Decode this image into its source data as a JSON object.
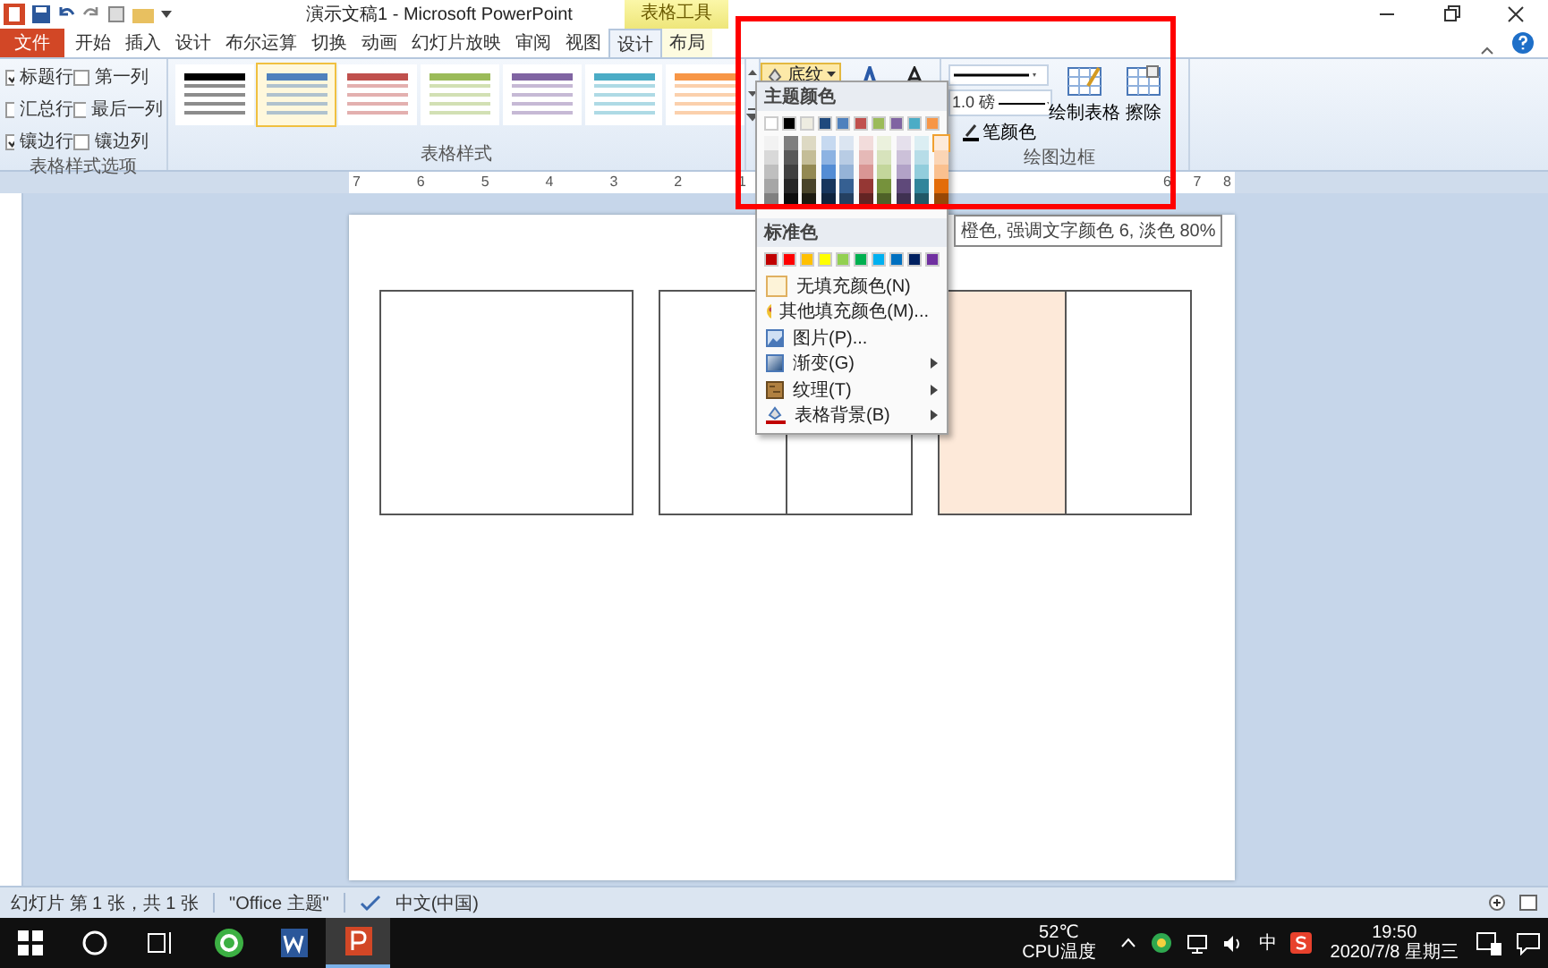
{
  "window": {
    "title": "演示文稿1 - Microsoft PowerPoint",
    "context_group": "表格工具"
  },
  "tabs": [
    {
      "label": "文件",
      "kind": "file",
      "selected": false
    },
    {
      "label": "开始",
      "kind": "normal",
      "selected": false
    },
    {
      "label": "插入",
      "kind": "normal",
      "selected": false
    },
    {
      "label": "设计",
      "kind": "normal",
      "selected": false
    },
    {
      "label": "布尔运算",
      "kind": "normal",
      "selected": false
    },
    {
      "label": "切换",
      "kind": "normal",
      "selected": false
    },
    {
      "label": "动画",
      "kind": "normal",
      "selected": false
    },
    {
      "label": "幻灯片放映",
      "kind": "normal",
      "selected": false
    },
    {
      "label": "审阅",
      "kind": "normal",
      "selected": false
    },
    {
      "label": "视图",
      "kind": "normal",
      "selected": false
    },
    {
      "label": "设计",
      "kind": "context",
      "selected": true
    },
    {
      "label": "布局",
      "kind": "context",
      "selected": false
    }
  ],
  "style_options": {
    "group_label": "表格样式选项",
    "items": [
      {
        "label": "标题行",
        "checked": true
      },
      {
        "label": "第一列",
        "checked": false
      },
      {
        "label": "汇总行",
        "checked": false
      },
      {
        "label": "最后一列",
        "checked": false
      },
      {
        "label": "镶边行",
        "checked": true
      },
      {
        "label": "镶边列",
        "checked": false
      }
    ]
  },
  "table_styles": {
    "group_label": "表格样式",
    "styles": [
      {
        "color": "#000000",
        "selected": false
      },
      {
        "color": "#4f81bd",
        "selected": true
      },
      {
        "color": "#c0504d",
        "selected": false
      },
      {
        "color": "#9bbb59",
        "selected": false
      },
      {
        "color": "#8064a2",
        "selected": false
      },
      {
        "color": "#4bacc6",
        "selected": false
      },
      {
        "color": "#f79646",
        "selected": false
      }
    ]
  },
  "shading_button": {
    "label": "底纹"
  },
  "draw_borders": {
    "group_label": "绘图边框",
    "pen_weight": "1.0 磅",
    "pen_color": "笔颜色",
    "draw_table": "绘制表格",
    "eraser": "擦除"
  },
  "ruler": {
    "left_labels": [
      "7",
      "6",
      "5",
      "4",
      "3",
      "2",
      "1"
    ],
    "right_labels": [
      "6",
      "7",
      "8"
    ]
  },
  "slide": {
    "tables": [
      {
        "cells": [
          {
            "shaded": false
          }
        ]
      },
      {
        "cells": [
          {
            "shaded": false
          },
          {
            "shaded": false
          }
        ]
      },
      {
        "cells": [
          {
            "shaded": true
          },
          {
            "shaded": false
          }
        ]
      }
    ]
  },
  "shading_menu": {
    "theme_header": "主题颜色",
    "standard_header": "标准色",
    "tooltip": "橙色, 强调文字颜色 6, 淡色 80%",
    "theme_colors": [
      {
        "color": "#ffffff",
        "selected": false,
        "shades": [
          {
            "color": "#f2f2f2",
            "selected": false
          },
          {
            "color": "#d9d9d9",
            "selected": false
          },
          {
            "color": "#bfbfbf",
            "selected": false
          },
          {
            "color": "#a6a6a6",
            "selected": false
          },
          {
            "color": "#808080",
            "selected": false
          }
        ]
      },
      {
        "color": "#000000",
        "selected": false,
        "shades": [
          {
            "color": "#7f7f7f",
            "selected": false
          },
          {
            "color": "#595959",
            "selected": false
          },
          {
            "color": "#404040",
            "selected": false
          },
          {
            "color": "#262626",
            "selected": false
          },
          {
            "color": "#0d0d0d",
            "selected": false
          }
        ]
      },
      {
        "color": "#eeece1",
        "selected": false,
        "shades": [
          {
            "color": "#ddd9c3",
            "selected": false
          },
          {
            "color": "#c4bd97",
            "selected": false
          },
          {
            "color": "#938953",
            "selected": false
          },
          {
            "color": "#494429",
            "selected": false
          },
          {
            "color": "#1d1b10",
            "selected": false
          }
        ]
      },
      {
        "color": "#1f497d",
        "selected": false,
        "shades": [
          {
            "color": "#c6d9f0",
            "selected": false
          },
          {
            "color": "#8db3e2",
            "selected": false
          },
          {
            "color": "#548dd4",
            "selected": false
          },
          {
            "color": "#17365d",
            "selected": false
          },
          {
            "color": "#0f243e",
            "selected": false
          }
        ]
      },
      {
        "color": "#4f81bd",
        "selected": false,
        "shades": [
          {
            "color": "#dbe5f1",
            "selected": false
          },
          {
            "color": "#b8cce4",
            "selected": false
          },
          {
            "color": "#95b3d7",
            "selected": false
          },
          {
            "color": "#366092",
            "selected": false
          },
          {
            "color": "#244061",
            "selected": false
          }
        ]
      },
      {
        "color": "#c0504d",
        "selected": false,
        "shades": [
          {
            "color": "#f2dcdb",
            "selected": false
          },
          {
            "color": "#e5b9b7",
            "selected": false
          },
          {
            "color": "#d99694",
            "selected": false
          },
          {
            "color": "#953734",
            "selected": false
          },
          {
            "color": "#632423",
            "selected": false
          }
        ]
      },
      {
        "color": "#9bbb59",
        "selected": false,
        "shades": [
          {
            "color": "#ebf1dd",
            "selected": false
          },
          {
            "color": "#d7e3bc",
            "selected": false
          },
          {
            "color": "#c3d69b",
            "selected": false
          },
          {
            "color": "#76923c",
            "selected": false
          },
          {
            "color": "#4f6128",
            "selected": false
          }
        ]
      },
      {
        "color": "#8064a2",
        "selected": false,
        "shades": [
          {
            "color": "#e5e0ec",
            "selected": false
          },
          {
            "color": "#ccc1d9",
            "selected": false
          },
          {
            "color": "#b2a2c7",
            "selected": false
          },
          {
            "color": "#5f497a",
            "selected": false
          },
          {
            "color": "#3f3151",
            "selected": false
          }
        ]
      },
      {
        "color": "#4bacc6",
        "selected": false,
        "shades": [
          {
            "color": "#dbeef3",
            "selected": false
          },
          {
            "color": "#b7dde8",
            "selected": false
          },
          {
            "color": "#92cddc",
            "selected": false
          },
          {
            "color": "#31859b",
            "selected": false
          },
          {
            "color": "#205867",
            "selected": false
          }
        ]
      },
      {
        "color": "#f79646",
        "selected": false,
        "shades": [
          {
            "color": "#fdeada",
            "selected": true
          },
          {
            "color": "#fbd5b5",
            "selected": false
          },
          {
            "color": "#fac08f",
            "selected": false
          },
          {
            "color": "#e36c09",
            "selected": false
          },
          {
            "color": "#974806",
            "selected": false
          }
        ]
      }
    ],
    "standard_colors": [
      {
        "color": "#c00000",
        "selected": false
      },
      {
        "color": "#ff0000",
        "selected": false
      },
      {
        "color": "#ffc000",
        "selected": false
      },
      {
        "color": "#ffff00",
        "selected": false
      },
      {
        "color": "#92d050",
        "selected": false
      },
      {
        "color": "#00b050",
        "selected": false
      },
      {
        "color": "#00b0f0",
        "selected": false
      },
      {
        "color": "#0070c0",
        "selected": false
      },
      {
        "color": "#002060",
        "selected": false
      },
      {
        "color": "#7030a0",
        "selected": false
      }
    ],
    "items": [
      {
        "label": "无填充颜色(N)",
        "kind": "no-fill",
        "submenu": false
      },
      {
        "label": "其他填充颜色(M)...",
        "kind": "more-colors",
        "submenu": false
      },
      {
        "label": "图片(P)...",
        "kind": "picture",
        "submenu": false
      },
      {
        "label": "渐变(G)",
        "kind": "gradient",
        "submenu": true
      },
      {
        "label": "纹理(T)",
        "kind": "texture",
        "submenu": true
      },
      {
        "label": "表格背景(B)",
        "kind": "table-background",
        "submenu": true
      }
    ]
  },
  "status_bar": {
    "slide_info": "幻灯片 第 1 张，共 1 张",
    "theme": "\"Office 主题\"",
    "language": "中文(中国)"
  },
  "taskbar": {
    "apps": [
      {
        "kind": "ie",
        "active": false
      },
      {
        "kind": "word",
        "active": false
      },
      {
        "kind": "powerpoint",
        "active": true
      }
    ],
    "temperature": "52℃",
    "temperature_label": "CPU温度",
    "ime": "中",
    "time": "19:50",
    "date": "2020/7/8 星期三"
  }
}
